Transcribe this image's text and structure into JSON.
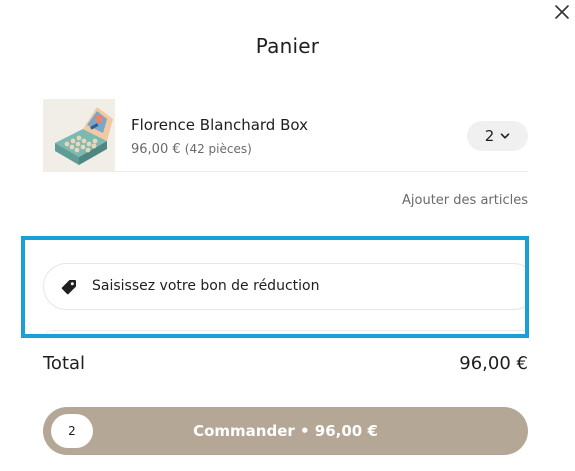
{
  "header": {
    "title": "Panier"
  },
  "cart": {
    "items": [
      {
        "name": "Florence Blanchard Box",
        "price": "96,00 €",
        "pieces": "(42 pièces)",
        "quantity": "2",
        "thumbnail_icon": "product-box-image"
      }
    ],
    "add_items_label": "Ajouter des articles"
  },
  "promo": {
    "placeholder": "Saisissez votre bon de réduction",
    "icon": "tag-icon"
  },
  "summary": {
    "total_label": "Total",
    "total_value": "96,00 €"
  },
  "checkout": {
    "count": "2",
    "label": "Commander • 96,00 €"
  },
  "colors": {
    "checkout_bg": "#b4a795",
    "highlight_border": "#1a9fd6",
    "qty_bg": "#f0f0f0"
  }
}
